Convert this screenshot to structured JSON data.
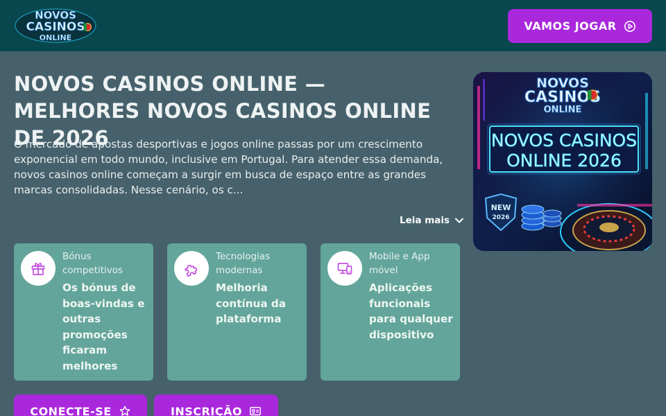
{
  "header": {
    "logo_text": [
      "NOVOS",
      "CASINOS",
      "ONLINE"
    ],
    "play_button": "VAMOS JOGAR"
  },
  "main": {
    "title": "NOVOS CASINOS ONLINE — MELHORES NOVOS CASINOS ONLINE DE 2026",
    "intro": "O mercado de apostas desportivas e jogos online passas por um crescimento exponencial em todo mundo, inclusive em Portugal. Para atender essa demanda, novos casinos online começam a surgir em busca de espaço entre as grandes marcas consolidadas. Nesse cenário, os c...",
    "read_more": "Leia mais"
  },
  "hero": {
    "logo_text": [
      "NOVOS",
      "CASINOS",
      "ONLINE"
    ],
    "neon_line1": "NOVOS CASINOS",
    "neon_line2": "ONLINE 2026",
    "badge_line1": "NEW",
    "badge_line2": "2026"
  },
  "features": [
    {
      "icon": "gift-icon",
      "category": "Bónus competitivos",
      "description": "Os bónus de boas-vindas e outras promoções ficaram melhores"
    },
    {
      "icon": "puzzle-icon",
      "category": "Tecnologias modernas",
      "description": "Melhoria contínua da plataforma"
    },
    {
      "icon": "devices-icon",
      "category": "Mobile e App móvel",
      "description": "Aplicações funcionais para qualquer dispositivo"
    }
  ],
  "actions": {
    "connect": "CONECTE-SE",
    "signup": "INSCRIÇÃO"
  },
  "colors": {
    "header_bg": "#08474d",
    "page_bg": "#46616b",
    "accent": "#a928dc",
    "card_bg": "#63a59a",
    "icon_color": "#c44fe0"
  }
}
